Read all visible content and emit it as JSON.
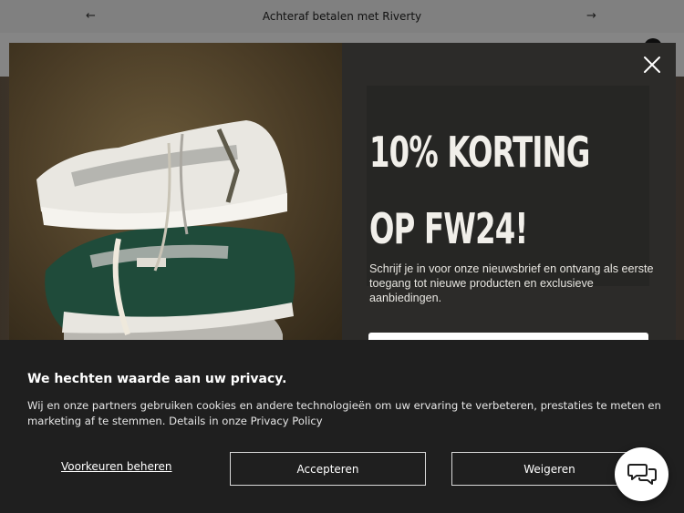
{
  "announcement": {
    "text": "Achteraf betalen met Riverty",
    "prev_icon": "arrow-left-icon",
    "next_icon": "arrow-right-icon"
  },
  "popup": {
    "headline_line1": "10% KORTING",
    "headline_line2": "OP FW24!",
    "body": "Schrijf je in voor onze nieuwsbrief en ontvang als eerste toegang tot nieuwe producten en exclusieve aanbiedingen.",
    "email_placeholder": "",
    "close_icon": "close-icon",
    "image_alt": "Stack of three sneakers"
  },
  "cookie_banner": {
    "title": "We hechten waarde aan uw privacy.",
    "text": "Wij en onze partners gebruiken cookies en andere technologieën om uw ervaring te verbeteren, prestaties te meten en marketing af te stemmen. Details in onze",
    "policy_link": "Privacy Policy",
    "manage_label": "Voorkeuren beheren",
    "accept_label": "Accepteren",
    "reject_label": "Weigeren"
  },
  "chat": {
    "icon": "chat-bubbles-icon"
  },
  "colors": {
    "popup_bg": "#2c2b29",
    "cookie_bg": "#1f1f1f",
    "text_light": "#f1efea"
  }
}
